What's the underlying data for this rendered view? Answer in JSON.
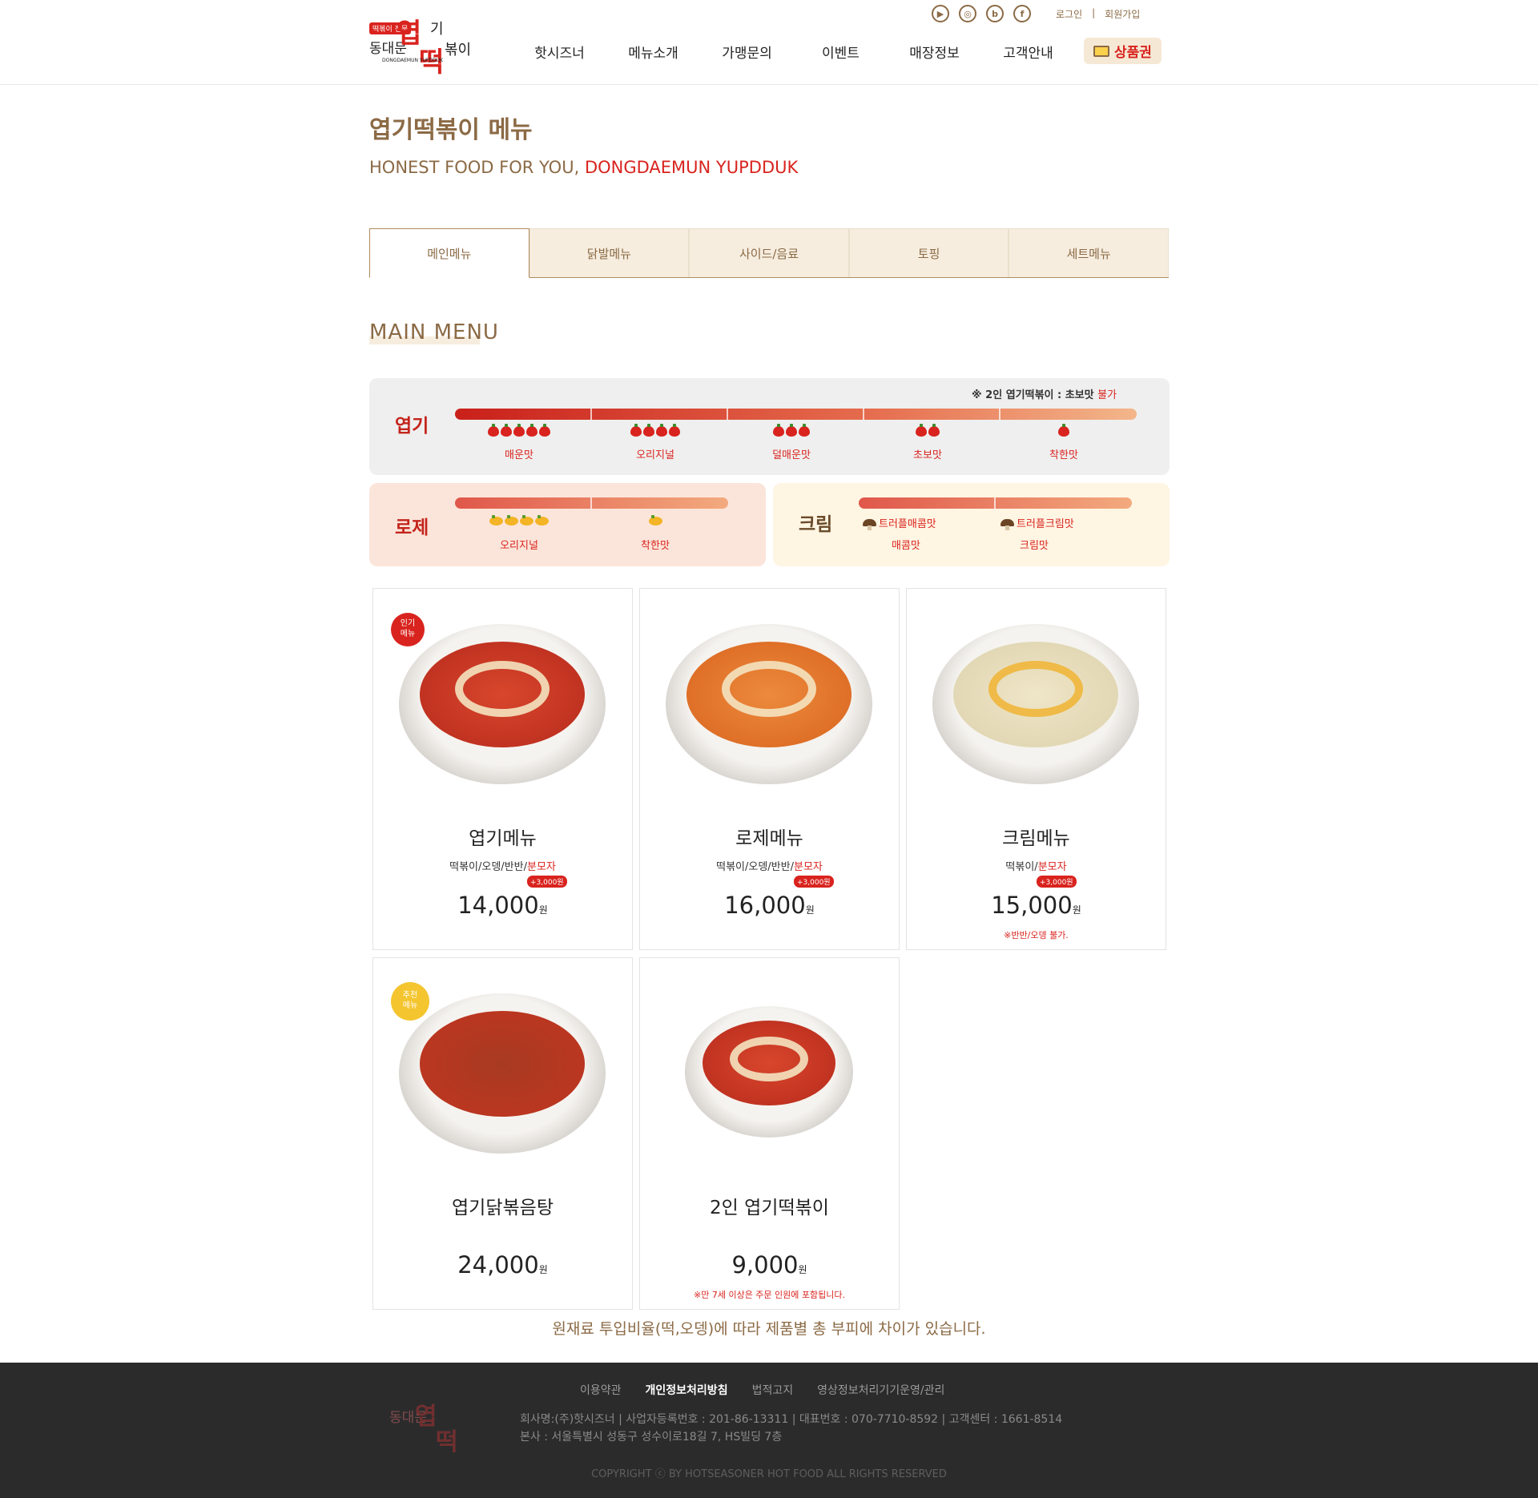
{
  "header": {
    "logo": {
      "tag": "떡볶이 전문",
      "line_a": "동대문",
      "line_b": "엽",
      "line_c": "기",
      "line_d": "떡",
      "line_e": "볶이",
      "en": "DONGDAEMUN YUPDDUK"
    },
    "social": [
      "youtube-icon",
      "instagram-icon",
      "blog-icon",
      "facebook-icon"
    ],
    "social_glyphs": [
      "▶",
      "◎",
      "b",
      "f"
    ],
    "login": "로그인",
    "divider": "|",
    "signup": "회원가입",
    "nav": [
      "핫시즈너",
      "메뉴소개",
      "가맹문의",
      "이벤트",
      "매장정보",
      "고객안내"
    ],
    "voucher": "상품권"
  },
  "page": {
    "title": "엽기떡볶이 메뉴",
    "subtitle_a": "HONEST FOOD FOR YOU,",
    "subtitle_b": "DONGDAEMUN YUPDDUK"
  },
  "tabs": [
    "메인메뉴",
    "닭발메뉴",
    "사이드/음료",
    "토핑",
    "세트메뉴"
  ],
  "section_title": "MAIN MENU",
  "spice": {
    "note_a": "※ 2인 엽기떡볶이 : 초보맛",
    "note_b": "불가",
    "yupgi": {
      "label": "엽기",
      "levels": [
        {
          "name": "매운맛",
          "peppers": 5
        },
        {
          "name": "오리지널",
          "peppers": 4
        },
        {
          "name": "덜매운맛",
          "peppers": 3
        },
        {
          "name": "초보맛",
          "peppers": 2
        },
        {
          "name": "착한맛",
          "peppers": 1
        }
      ]
    },
    "rose": {
      "label": "로제",
      "levels": [
        {
          "name": "오리지널",
          "count": 4
        },
        {
          "name": "착한맛",
          "count": 1
        }
      ]
    },
    "cream": {
      "label": "크림",
      "levels": [
        {
          "name": "트러플매콤맛",
          "sub": "매콤맛"
        },
        {
          "name": "트러플크림맛",
          "sub": "크림맛"
        }
      ]
    }
  },
  "menu": [
    {
      "badge": "인기\n메뉴",
      "name": "엽기메뉴",
      "desc_a": "떡볶이/오뎅/반반/",
      "desc_b": "분모자",
      "extra": "+3,000원",
      "price": "14,000",
      "unit": "원",
      "note": ""
    },
    {
      "badge": "",
      "name": "로제메뉴",
      "desc_a": "떡볶이/오뎅/반반/",
      "desc_b": "분모자",
      "extra": "+3,000원",
      "price": "16,000",
      "unit": "원",
      "note": ""
    },
    {
      "badge": "",
      "name": "크림메뉴",
      "desc_a": "떡볶이/",
      "desc_b": "분모자",
      "extra": "+3,000원",
      "price": "15,000",
      "unit": "원",
      "note": "※반반/오뎅 불가."
    },
    {
      "badge": "추천\n메뉴",
      "name": "엽기닭볶음탕",
      "desc_a": "",
      "desc_b": "",
      "extra": "",
      "price": "24,000",
      "unit": "원",
      "note": ""
    },
    {
      "badge": "",
      "name": "2인 엽기떡볶이",
      "desc_a": "",
      "desc_b": "",
      "extra": "",
      "price": "9,000",
      "unit": "원",
      "note": "※만 7세 이상은 주문 인원에 포함됩니다."
    }
  ],
  "disclaimer": "원재료 투입비율(떡,오뎅)에 따라 제품별 총 부피에 차이가 있습니다.",
  "footer": {
    "links": [
      "이용약관",
      "개인정보처리방침",
      "법적고지",
      "영상정보처리기기운영/관리"
    ],
    "info_1": "회사명:(주)핫시즈너  |  사업자등록번호 : 201-86-13311  |  대표번호 : 070-7710-8592  |  고객센터 : 1661-8514",
    "info_2": "본사 : 서울특별시 성동구 성수이로18길 7, HS빌딩 7층",
    "copyright": "COPYRIGHT ⓒ BY HOTSEASONER HOT FOOD ALL RIGHTS RESERVED"
  },
  "colors": {
    "brand_red": "#d9231e",
    "brown": "#8b6a45",
    "tab_bg": "#f6eddf",
    "footer_bg": "#2b2b2c"
  }
}
